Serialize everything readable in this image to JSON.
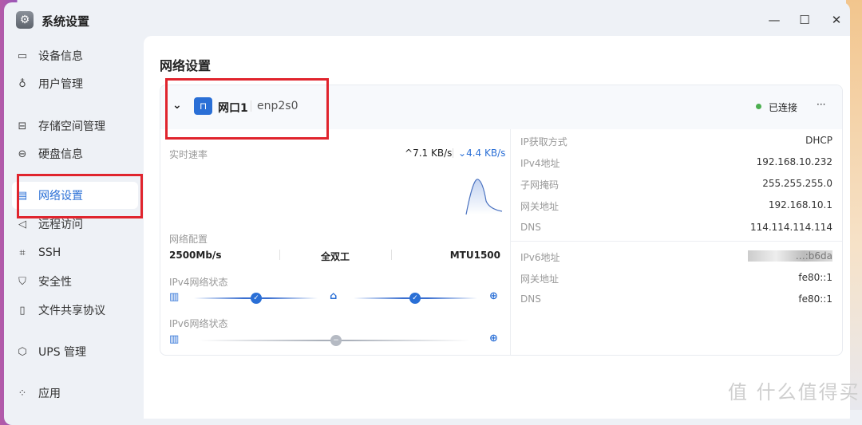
{
  "window": {
    "title": "系统设置",
    "minimize": "—",
    "maximize": "☐",
    "close": "✕"
  },
  "sidebar": {
    "items": [
      {
        "label": "设备信息",
        "icon": "▭"
      },
      {
        "label": "用户管理",
        "icon": "♁"
      },
      {
        "label": "存储空间管理",
        "icon": "⊟"
      },
      {
        "label": "硬盘信息",
        "icon": "⊖"
      },
      {
        "label": "网络设置",
        "icon": "▤",
        "active": true
      },
      {
        "label": "远程访问",
        "icon": "◁"
      },
      {
        "label": "SSH",
        "icon": "⌗"
      },
      {
        "label": "安全性",
        "icon": "⛉"
      },
      {
        "label": "文件共享协议",
        "icon": "▯"
      },
      {
        "label": "UPS 管理",
        "icon": "⬡"
      },
      {
        "label": "应用",
        "icon": "⁘"
      }
    ]
  },
  "page": {
    "title": "网络设置"
  },
  "interface": {
    "name": "网口1",
    "device": "enp2s0",
    "status": "已连接",
    "status_color": "#4caf50",
    "more": "···",
    "speed_label": "实时速率",
    "upload": "7.1 KB/s",
    "download": "4.4 KB/s",
    "config_label": "网络配置",
    "link_speed": "2500Mb/s",
    "duplex": "全双工",
    "mtu": "MTU1500",
    "ipv4_status_label": "IPv4网络状态",
    "ipv6_status_label": "IPv6网络状态"
  },
  "ipv4": [
    {
      "k": "IP获取方式",
      "v": "DHCP"
    },
    {
      "k": "IPv4地址",
      "v": "192.168.10.232"
    },
    {
      "k": "子网掩码",
      "v": "255.255.255.0"
    },
    {
      "k": "网关地址",
      "v": "192.168.10.1"
    },
    {
      "k": "DNS",
      "v": "114.114.114.114"
    }
  ],
  "ipv6": [
    {
      "k": "IPv6地址",
      "v": "…:b6da"
    },
    {
      "k": "网关地址",
      "v": "fe80::1"
    },
    {
      "k": "DNS",
      "v": "fe80::1"
    }
  ],
  "watermark": "值 什么值得买",
  "colors": {
    "accent": "#2a6fd6",
    "highlight": "#e0242d"
  }
}
